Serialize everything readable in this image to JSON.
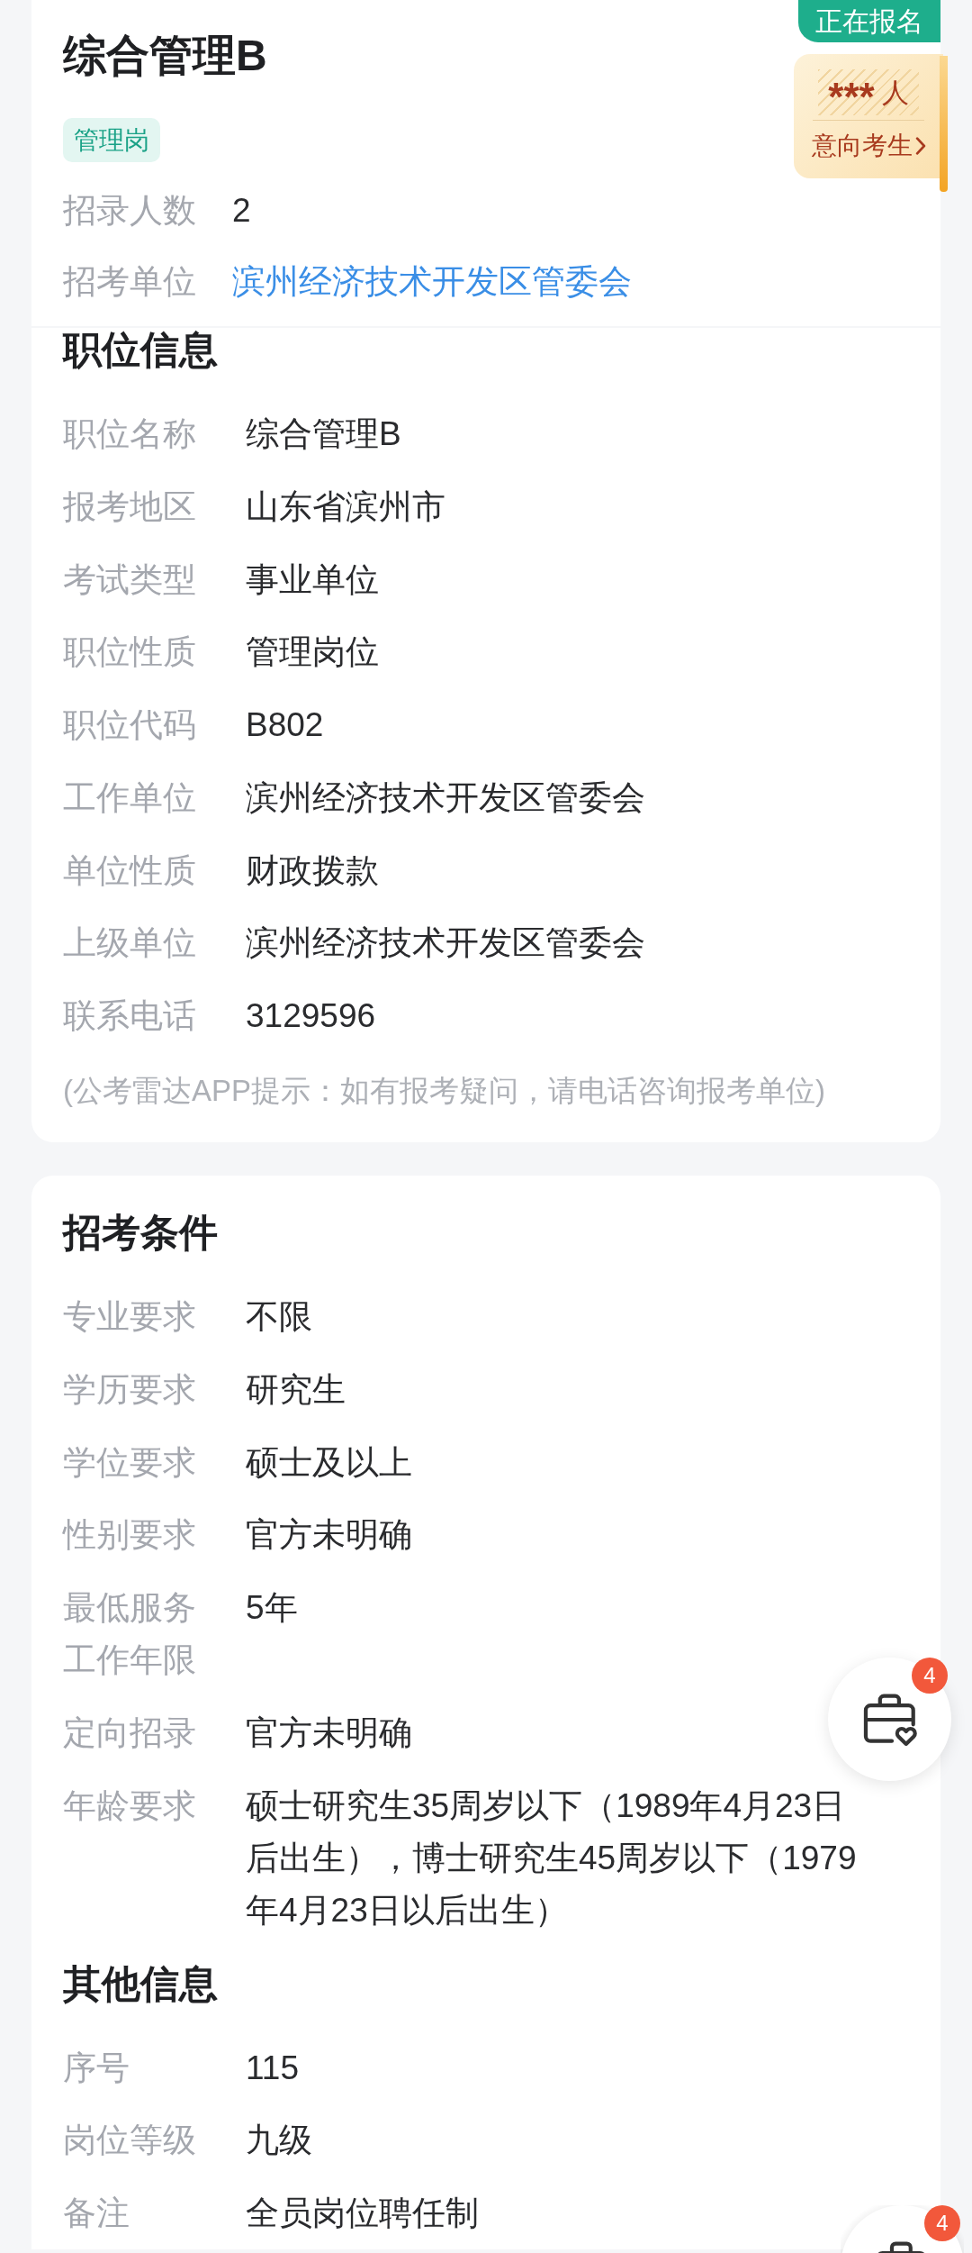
{
  "header": {
    "status": "正在报名",
    "title": "综合管理B",
    "tag": "管理岗",
    "fields": [
      {
        "label": "招录人数",
        "value": "2",
        "kind": "text"
      },
      {
        "label": "招考单位",
        "value": "滨州经济技术开发区管委会",
        "kind": "link"
      }
    ]
  },
  "applicants": {
    "count": "***",
    "unit": "人",
    "link": "意向考生"
  },
  "cards": [
    {
      "sections": [
        {
          "title": "职位信息",
          "rows": [
            {
              "label": "职位名称",
              "value": "综合管理B"
            },
            {
              "label": "报考地区",
              "value": "山东省滨州市"
            },
            {
              "label": "考试类型",
              "value": "事业单位"
            },
            {
              "label": "职位性质",
              "value": "管理岗位"
            },
            {
              "label": "职位代码",
              "value": "B802"
            },
            {
              "label": "工作单位",
              "value": "滨州经济技术开发区管委会"
            },
            {
              "label": "单位性质",
              "value": "财政拨款"
            },
            {
              "label": "上级单位",
              "value": "滨州经济技术开发区管委会"
            },
            {
              "label": "联系电话",
              "value": "3129596"
            }
          ],
          "note": "(公考雷达APP提示：如有报考疑问，请电话咨询报考单位)"
        }
      ]
    },
    {
      "sections": [
        {
          "title": "招考条件",
          "rows": [
            {
              "label": "专业要求",
              "value": "不限"
            },
            {
              "label": "学历要求",
              "value": "研究生"
            },
            {
              "label": "学位要求",
              "value": "硕士及以上"
            },
            {
              "label": "性别要求",
              "value": "官方未明确"
            },
            {
              "label": "最低服务工作年限",
              "value": "5年"
            },
            {
              "label": "定向招录",
              "value": "官方未明确"
            },
            {
              "label": "年龄要求",
              "value": "硕士研究生35周岁以下（1989年4月23日后出生），博士研究生45周岁以下（1979年4月23日以后出生）"
            }
          ]
        },
        {
          "title": "其他信息",
          "rows": [
            {
              "label": "序号",
              "value": "115"
            },
            {
              "label": "岗位等级",
              "value": "九级"
            },
            {
              "label": "备注",
              "value": "全员岗位聘任制"
            }
          ]
        }
      ]
    }
  ],
  "floating_buttons": [
    {
      "kind": "full",
      "badge": "4"
    },
    {
      "kind": "clipped",
      "badge": "4"
    }
  ]
}
